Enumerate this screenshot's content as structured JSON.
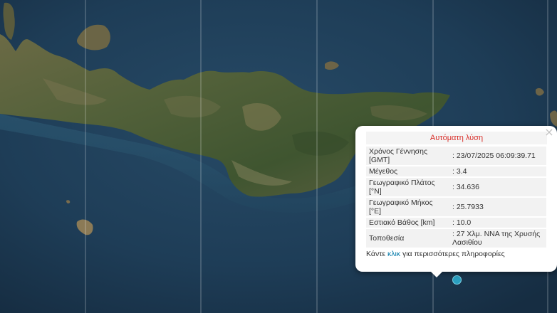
{
  "popup": {
    "title": "Αυτόματη λύση",
    "rows": [
      {
        "label": "Χρόνος Γέννησης [GMT]",
        "value": ": 23/07/2025 06:09:39.71"
      },
      {
        "label": "Μέγεθος",
        "value": ": 3.4"
      },
      {
        "label": "Γεωγραφικό Πλάτος [°N]",
        "value": ": 34.636"
      },
      {
        "label": "Γεωγραφικό Μήκος [°E]",
        "value": ": 25.7933"
      },
      {
        "label": "Εστιακό Βάθος [km]",
        "value": ": 10.0"
      },
      {
        "label": "Τοποθεσία",
        "value": ": 27 Χλμ. ΝΝΑ της Χρυσής Λασιθίου"
      }
    ],
    "footer_pre": "Κάντε ",
    "footer_link": "κλικ",
    "footer_post": " για περισσότερες πληροφορίες",
    "close_glyph": "×"
  },
  "map": {
    "sea_color": "#1d3a52",
    "land_color": "#4d5a33",
    "popup_title_color": "#d9302b",
    "marker_color": "#2a9fc0"
  }
}
